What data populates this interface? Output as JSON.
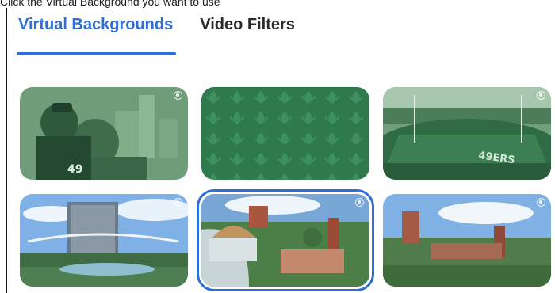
{
  "instruction": "Click the Virtual Background you want to use",
  "tabs": [
    {
      "label": "Virtual Backgrounds",
      "active": true
    },
    {
      "label": "Video Filters",
      "active": false
    }
  ],
  "colors": {
    "accent": "#2e6ed8",
    "tint_green": "#2d7a4e"
  },
  "backgrounds": [
    {
      "name": "mascot-green"
    },
    {
      "name": "pattern-green"
    },
    {
      "name": "stadium-green"
    },
    {
      "name": "modern-building-fountain"
    },
    {
      "name": "campus-dome-aerial",
      "selected": true
    },
    {
      "name": "campus-aerial-tower"
    }
  ]
}
